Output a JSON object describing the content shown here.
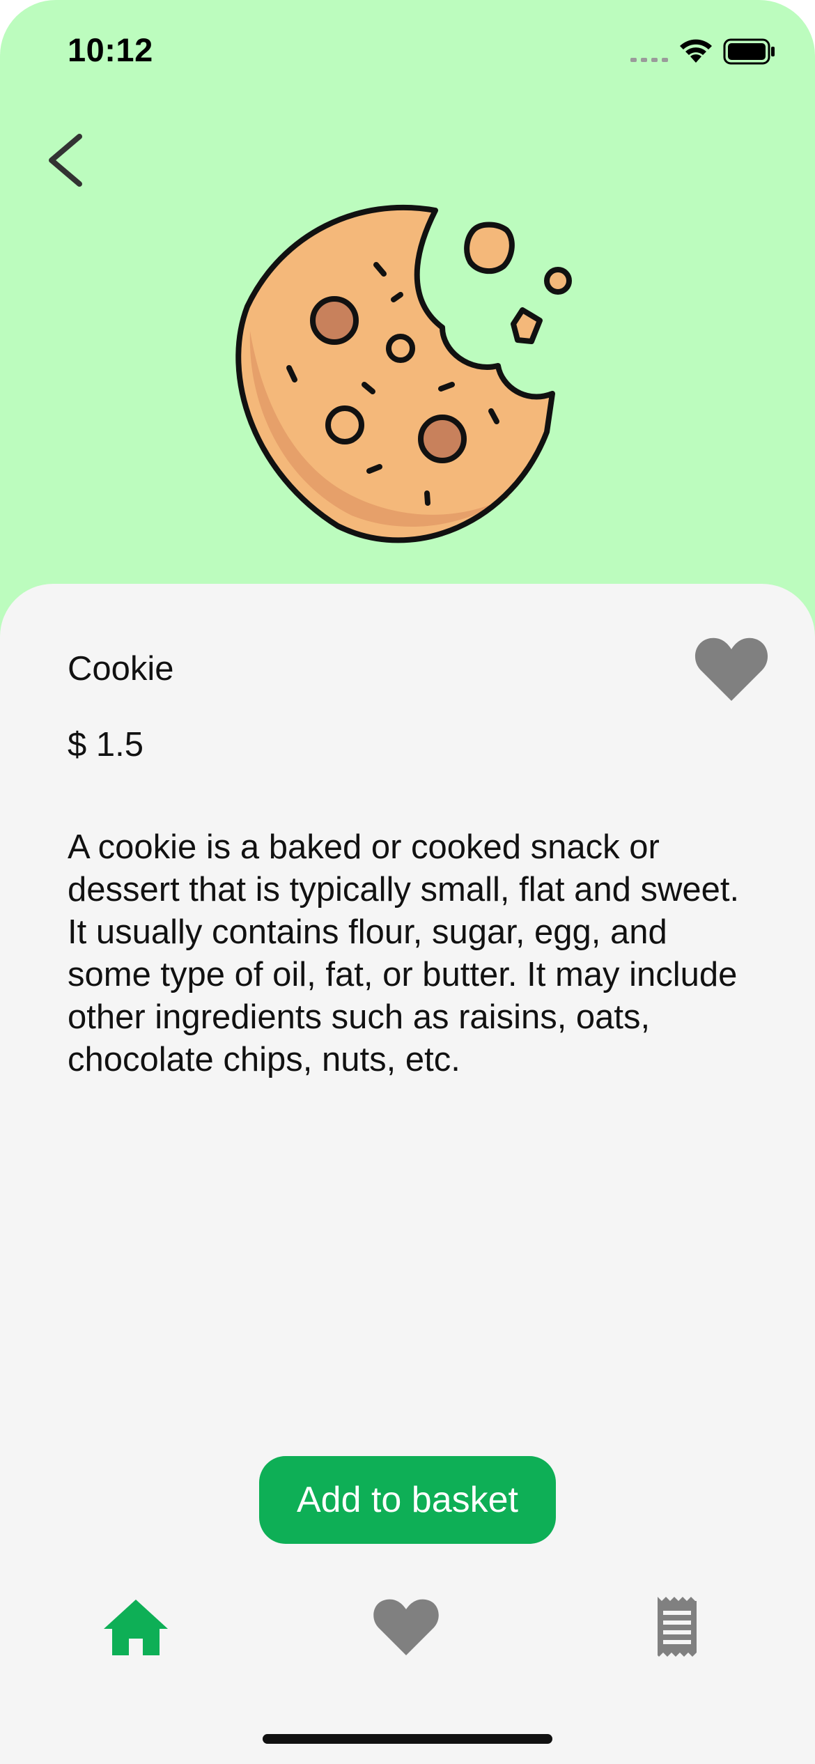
{
  "status_bar": {
    "time": "10:12"
  },
  "product": {
    "name": "Cookie",
    "price": "$ 1.5",
    "description": "A cookie is a baked or cooked snack or dessert that is typically small, flat and sweet. It usually contains flour, sugar, egg, and some type of oil, fat, or butter. It may include other ingredients such as raisins, oats, chocolate chips, nuts, etc.",
    "image_icon": "cookie-icon"
  },
  "actions": {
    "add_to_basket_label": "Add to basket"
  },
  "tab_bar": {
    "tabs": [
      {
        "icon": "home-icon",
        "active": true
      },
      {
        "icon": "heart-icon",
        "active": false
      },
      {
        "icon": "receipt-icon",
        "active": false
      }
    ]
  },
  "colors": {
    "header_background": "#bcfcbe",
    "sheet_background": "#f5f5f5",
    "accent": "#0eaf56",
    "inactive_icon": "#808080"
  }
}
